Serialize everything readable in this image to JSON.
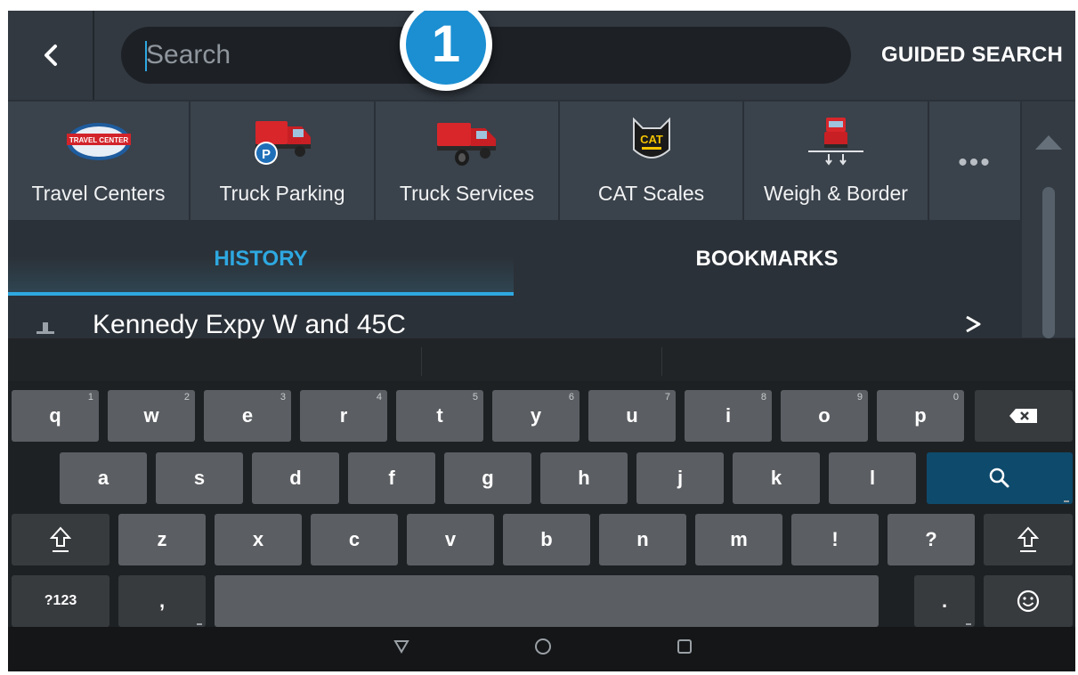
{
  "search": {
    "placeholder": "Search",
    "guided_label": "GUIDED SEARCH"
  },
  "step_badge": "1",
  "categories": [
    {
      "label": "Travel Centers",
      "icon": "travel-center-icon",
      "badge_text": "TRAVEL CENTER"
    },
    {
      "label": "Truck Parking",
      "icon": "truck-parking-icon",
      "badge_text": "P"
    },
    {
      "label": "Truck Services",
      "icon": "truck-services-icon"
    },
    {
      "label": "CAT Scales",
      "icon": "cat-scales-icon",
      "badge_text": "CAT"
    },
    {
      "label": "Weigh & Border",
      "icon": "weigh-border-icon"
    },
    {
      "label": "•••",
      "icon": "more-icon"
    }
  ],
  "tabs": {
    "history": "HISTORY",
    "bookmarks": "BOOKMARKS",
    "active": "history"
  },
  "history": [
    {
      "label": "Kennedy Expy W and 45C"
    }
  ],
  "keyboard": {
    "row1": [
      {
        "label": "q",
        "hint": "1"
      },
      {
        "label": "w",
        "hint": "2"
      },
      {
        "label": "e",
        "hint": "3"
      },
      {
        "label": "r",
        "hint": "4"
      },
      {
        "label": "t",
        "hint": "5"
      },
      {
        "label": "y",
        "hint": "6"
      },
      {
        "label": "u",
        "hint": "7"
      },
      {
        "label": "i",
        "hint": "8"
      },
      {
        "label": "o",
        "hint": "9"
      },
      {
        "label": "p",
        "hint": "0"
      }
    ],
    "row2": [
      "a",
      "s",
      "d",
      "f",
      "g",
      "h",
      "j",
      "k",
      "l"
    ],
    "row3": [
      "z",
      "x",
      "c",
      "v",
      "b",
      "n",
      "m",
      "!",
      "?"
    ],
    "symbols": "?123",
    "comma": ",",
    "period": "."
  },
  "colors": {
    "accent": "#2ea8e0",
    "search_key": "#0e4a6c",
    "badge": "#1b8fd2"
  }
}
